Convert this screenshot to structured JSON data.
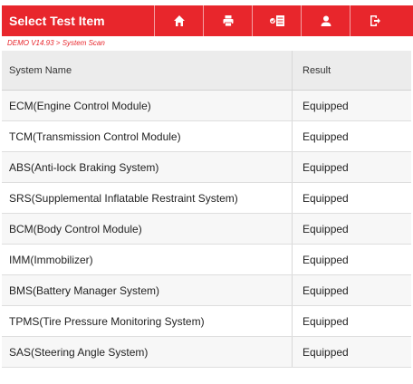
{
  "header": {
    "title": "Select Test Item",
    "bar_color": "#e8262c",
    "icons": [
      "home-icon",
      "print-icon",
      "report-icon",
      "user-icon",
      "exit-icon"
    ]
  },
  "breadcrumb": "DEMO V14.93 > System Scan",
  "table": {
    "columns": [
      "System Name",
      "Result"
    ],
    "rows": [
      {
        "name": "ECM(Engine Control Module)",
        "result": "Equipped"
      },
      {
        "name": "TCM(Transmission Control Module)",
        "result": "Equipped"
      },
      {
        "name": "ABS(Anti-lock Braking System)",
        "result": "Equipped"
      },
      {
        "name": "SRS(Supplemental Inflatable Restraint System)",
        "result": "Equipped"
      },
      {
        "name": "BCM(Body Control Module)",
        "result": "Equipped"
      },
      {
        "name": "IMM(Immobilizer)",
        "result": "Equipped"
      },
      {
        "name": "BMS(Battery Manager System)",
        "result": "Equipped"
      },
      {
        "name": "TPMS(Tire Pressure Monitoring System)",
        "result": "Equipped"
      },
      {
        "name": "SAS(Steering Angle System)",
        "result": "Equipped"
      }
    ]
  }
}
